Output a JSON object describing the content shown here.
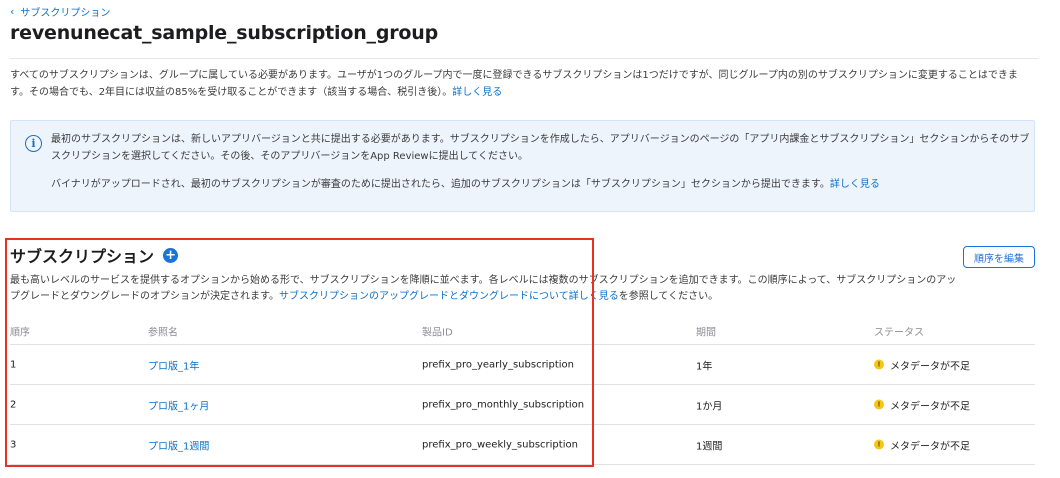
{
  "back_link": {
    "label": "サブスクリプション"
  },
  "page_title": "revenunecat_sample_subscription_group",
  "intro": {
    "text": "すべてのサブスクリプションは、グループに属している必要があります。ユーザが1つのグループ内で一度に登録できるサブスクリプションは1つだけですが、同じグループ内の別のサブスクリプションに変更することはできます。その場合でも、2年目には収益の85%を受け取ることができます（該当する場合、税引き後）。",
    "link": "詳しく見る"
  },
  "info_box": {
    "icon": "info-icon",
    "paragraph1": "最初のサブスクリプションは、新しいアプリバージョンと共に提出する必要があります。サブスクリプションを作成したら、アプリバージョンのページの「アプリ内課金とサブスクリプション」セクションからそのサブスクリプションを選択してください。その後、そのアプリバージョンをApp Reviewに提出してください。",
    "paragraph2": "バイナリがアップロードされ、最初のサブスクリプションが審査のために提出されたら、追加のサブスクリプションは「サブスクリプション」セクションから提出できます。",
    "link": "詳しく見る"
  },
  "section": {
    "title": "サブスクリプション",
    "add_icon": "plus-circle-icon",
    "edit_order_label": "順序を編集",
    "desc_before": "最も高いレベルのサービスを提供するオプションから始める形で、サブスクリプションを降順に並べます。各レベルには複数のサブスクリプションを追加できます。この順序によって、サブスクリプションのアップグレードとダウングレードのオプションが決定されます。",
    "desc_link": "サブスクリプションのアップグレードとダウングレードについて詳しく見る",
    "desc_after": "を参照してください。"
  },
  "table": {
    "headers": {
      "order": "順序",
      "ref_name": "参照名",
      "product_id": "製品ID",
      "duration": "期間",
      "status": "ステータス"
    },
    "rows": [
      {
        "order": "1",
        "ref_name": "プロ版_1年",
        "product_id": "prefix_pro_yearly_subscription",
        "duration": "1年",
        "status": "メタデータが不足"
      },
      {
        "order": "2",
        "ref_name": "プロ版_1ヶ月",
        "product_id": "prefix_pro_monthly_subscription",
        "duration": "1か月",
        "status": "メタデータが不足"
      },
      {
        "order": "3",
        "ref_name": "プロ版_1週間",
        "product_id": "prefix_pro_weekly_subscription",
        "duration": "1週間",
        "status": "メタデータが不足"
      }
    ],
    "status_icon": "warning-dot-icon",
    "status_color": "#f5c518"
  },
  "colors": {
    "link": "#0a70c9",
    "accent": "#1a73d9",
    "highlight": "#e8321f",
    "info_bg": "#eef4fb"
  }
}
